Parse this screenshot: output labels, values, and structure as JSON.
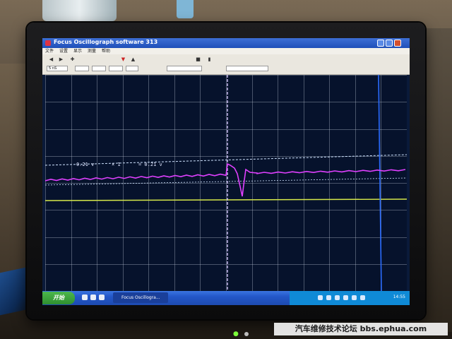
{
  "window": {
    "title": "Focus Oscillograph software 313",
    "controls": [
      "minimize",
      "maximize",
      "close"
    ]
  },
  "menu": {
    "items": [
      "文件",
      "设置",
      "显示",
      "测量",
      "帮助",
      "",
      "",
      ""
    ]
  },
  "toolbar": {
    "icons": [
      "back-icon",
      "forward-icon",
      "zoom-icon",
      "channel-icon",
      "trigger-icon",
      "lock-icon",
      "print-icon"
    ],
    "fields": [
      "5 nS",
      "",
      "",
      "",
      "",
      "",
      ""
    ]
  },
  "scope": {
    "cursor_left_label": "0.21 v",
    "multiplier_label": "× 1",
    "cursor_right_label": "= 0.21 v",
    "trace_color": "#e040ff",
    "cursor_color": "#cfe3ff",
    "reference_color": "#d6e84a",
    "marker_color": "#2b6cff",
    "grid_color": "#c8d2e0"
  },
  "taskbar": {
    "start_label": "开始",
    "task_label": "Focus Oscillogra...",
    "clock": "14:55"
  },
  "watermark": {
    "text": "汽车维修技术论坛 bbs.ephua.com"
  }
}
